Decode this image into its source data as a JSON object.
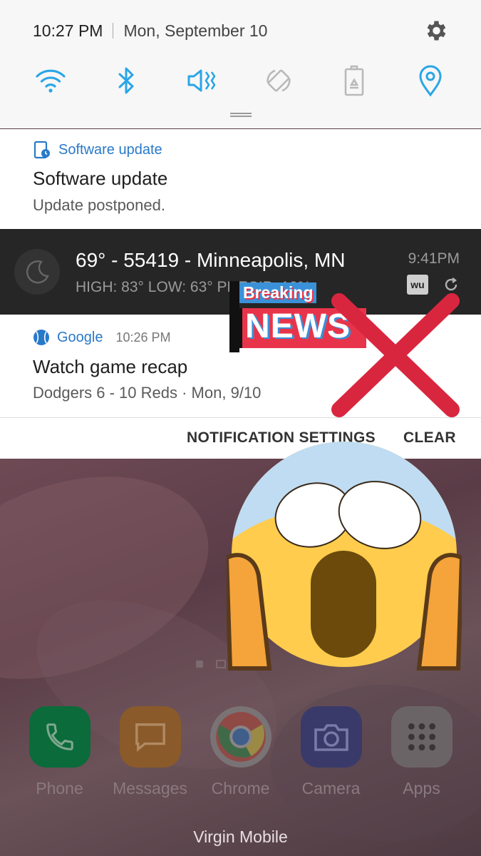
{
  "status_bar": {
    "time": "10:27 PM",
    "date": "Mon, September 10"
  },
  "quick_settings": [
    {
      "name": "wifi-icon",
      "active": true
    },
    {
      "name": "bluetooth-icon",
      "active": true
    },
    {
      "name": "vibrate-icon",
      "active": true
    },
    {
      "name": "auto-rotate-icon",
      "active": false
    },
    {
      "name": "power-saving-icon",
      "active": false
    },
    {
      "name": "location-icon",
      "active": true
    }
  ],
  "notifications": {
    "software_update": {
      "app": "Software update",
      "title": "Software update",
      "text": "Update postponed."
    },
    "weather": {
      "title": "69° - 55419 - Minneapolis, MN",
      "subtitle": "HIGH: 83° LOW: 63° PRECIP: 10%",
      "time": "9:41PM",
      "badge": "wu"
    },
    "google": {
      "app": "Google",
      "time": "10:26 PM",
      "title": "Watch game recap",
      "text": "Dodgers 6 - 10 Reds · Mon, 9/10"
    }
  },
  "actions": {
    "settings": "NOTIFICATION SETTINGS",
    "clear": "CLEAR"
  },
  "overlay": {
    "breaking": "Breaking",
    "news": "NEWS"
  },
  "dock": [
    {
      "label": "Phone",
      "color": "#0b6b3a"
    },
    {
      "label": "Messages",
      "color": "#8a5a2a"
    },
    {
      "label": "Chrome",
      "color": "#7a7375"
    },
    {
      "label": "Camera",
      "color": "#3a3a6a"
    },
    {
      "label": "Apps",
      "color": "#6b6466"
    }
  ],
  "carrier": "Virgin Mobile",
  "colors": {
    "accent": "#2aa6e6",
    "link": "#2979c9",
    "news_red": "#e8344a",
    "x_red": "#d9263f"
  }
}
